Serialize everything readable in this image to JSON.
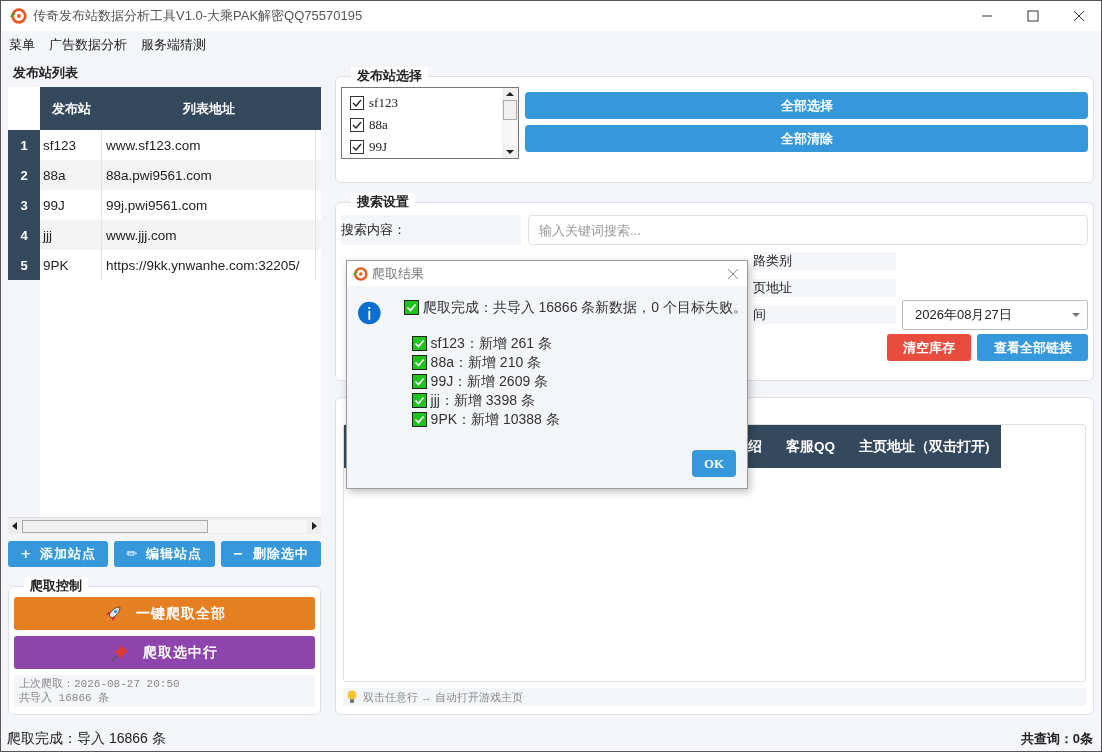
{
  "window": {
    "title": "传奇发布站数据分析工具V1.0-大乘PAK解密QQ75570195"
  },
  "menu": [
    "菜单",
    "广告数据分析",
    "服务端猜测"
  ],
  "site_list": {
    "title": "发布站列表",
    "columns": [
      "发布站",
      "列表地址"
    ],
    "rows": [
      {
        "index": "1",
        "site": "sf123",
        "url": "www.sf123.com"
      },
      {
        "index": "2",
        "site": "88a",
        "url": "88a.pwi9561.com"
      },
      {
        "index": "3",
        "site": "99J",
        "url": "99j.pwi9561.com"
      },
      {
        "index": "4",
        "site": "jjj",
        "url": "www.jjj.com"
      },
      {
        "index": "5",
        "site": "9PK",
        "url": "https://9kk.ynwanhe.com:32205/"
      }
    ]
  },
  "site_buttons": [
    {
      "icon": "+",
      "label": "添加站点"
    },
    {
      "icon": "✏",
      "label": "编辑站点"
    },
    {
      "icon": "−",
      "label": "删除选中"
    }
  ],
  "crawl_control": {
    "title": "爬取控制",
    "buttons": [
      {
        "kind": "rocket",
        "label": "一键爬取全部"
      },
      {
        "kind": "pin",
        "label": "爬取选中行"
      }
    ],
    "info": [
      "上次爬取：2026-08-27 20:50",
      "共导入 16866 条"
    ]
  },
  "site_select": {
    "title": "发布站选择",
    "items": [
      {
        "label": "sf123",
        "checked": true
      },
      {
        "label": "88a",
        "checked": true
      },
      {
        "label": "99J",
        "checked": true
      }
    ],
    "buttons": [
      "全部选择",
      "全部清除"
    ]
  },
  "search": {
    "title": "搜索设置",
    "label": "搜索内容：",
    "placeholder": "输入关键词搜索...",
    "partial_labels": [
      "路类别",
      "页地址",
      "间"
    ],
    "date": "2026年08月27日",
    "buttons": [
      {
        "kind": "danger",
        "label": "清空库存"
      },
      {
        "kind": "primary",
        "label": "查看全部链接"
      }
    ]
  },
  "results": {
    "columns": [
      "绍",
      "客服QQ",
      "主页地址（双击打开)"
    ],
    "tip": "双击任意行 → 自动打开游戏主页"
  },
  "status_bar": {
    "left": "爬取完成：导入 16866 条",
    "right": "共查询：0条"
  },
  "dialog": {
    "title": "爬取结果",
    "summary": "爬取完成：共导入 16866 条新数据，0 个目标失败。",
    "items": [
      "sf123：新增 261 条",
      "88a：新增 210 条",
      "99J：新增 2609 条",
      "jjj：新增 3398 条",
      "9PK：新增 10388 条"
    ],
    "button": "OK"
  }
}
